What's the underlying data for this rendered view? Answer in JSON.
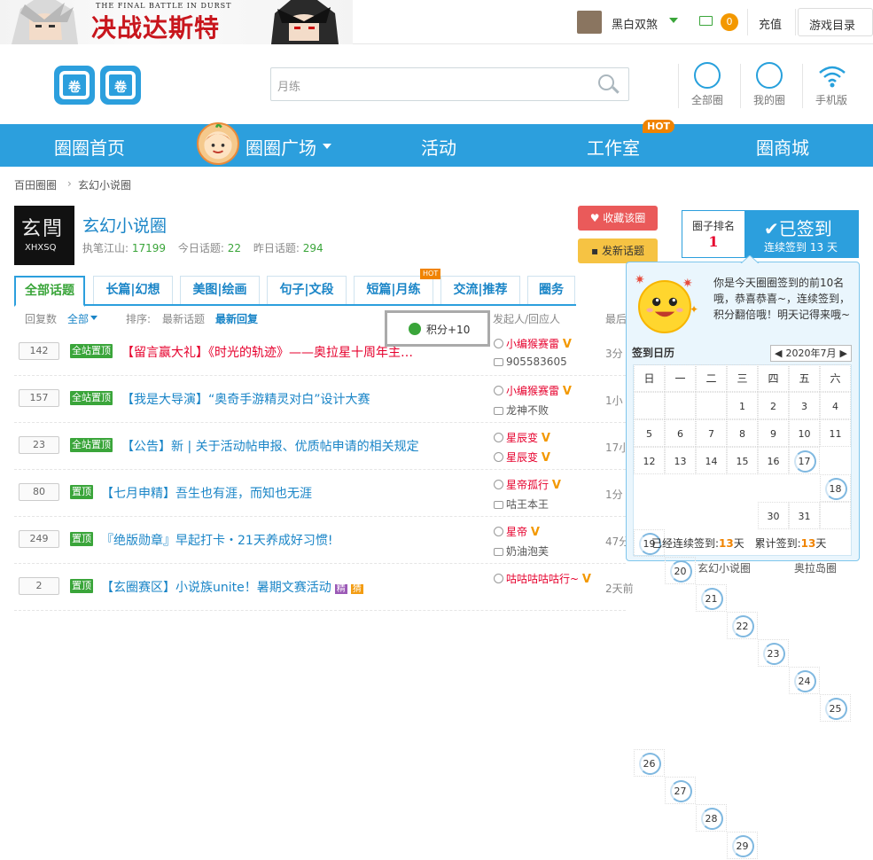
{
  "topbar": {
    "banner_subtitle": "THE FINAL BATTLE IN DURST",
    "banner_title": "决战达斯特",
    "username": "黑白双煞",
    "mail_count": "0",
    "recharge": "充值",
    "game_directory": "游戏目录"
  },
  "header": {
    "logo_text": "圈圈",
    "search_value": "月练",
    "links": [
      "全部圈",
      "我的圈",
      "手机版"
    ]
  },
  "nav": {
    "items": [
      "圈圈首页",
      "圈圈广场",
      "活动",
      "工作室",
      "圈商城"
    ],
    "hot_badge": "HOT"
  },
  "breadcrumb": [
    "百田圈圈",
    "玄幻小说圈"
  ],
  "group": {
    "avatar_text": "玄閆",
    "avatar_sub": "XHXSQ",
    "name": "玄幻小说圈",
    "owner_label": "执笔江山:",
    "owner_value": "17199",
    "today_label": "今日话题:",
    "today_value": "22",
    "yesterday_label": "昨日话题:",
    "yesterday_value": "294",
    "fav_button": "收藏该圈",
    "post_button": "发新话题"
  },
  "ranking": {
    "label": "圈子排名",
    "value": "1",
    "signed": "已签到",
    "streak_label": "连续签到",
    "streak_value": "13",
    "streak_unit": "天"
  },
  "tabs": [
    "全部话题",
    "长篇|幻想",
    "美图|绘画",
    "句子|文段",
    "短篇|月练",
    "交流|推荐",
    "圈务"
  ],
  "tab_hot": "HOT",
  "filter": {
    "reply_label": "回复数",
    "all": "全部",
    "sort_label": "排序:",
    "latest_topic": "最新话题",
    "latest_reply": "最新回复",
    "author_col": "发起人/回应人",
    "time_col": "最后"
  },
  "topics": [
    {
      "count": "142",
      "tag": "全站置顶",
      "title_red": "【留言赢大礼】《时光的轨迹》——奥拉星十周年主…",
      "title": "",
      "author": "小编猴赛雷",
      "responder": "905583605",
      "time": "3分"
    },
    {
      "count": "157",
      "tag": "全站置顶",
      "title_red": "",
      "title": "【我是大导演】“奥奇手游精灵对白”设计大赛",
      "author": "小编猴赛雷",
      "responder": "龙神不败",
      "time": "1小"
    },
    {
      "count": "23",
      "tag": "全站置顶",
      "title_red": "",
      "title": "【公告】新 | 关于活动帖申报、优质帖申请的相关规定",
      "author": "星辰变",
      "responder": "星辰变",
      "time": "17小"
    },
    {
      "count": "80",
      "tag": "置顶",
      "title_red": "",
      "title": "【七月申精】吾生也有涯，而知也无涯",
      "author": "星帝孤行",
      "responder": "咕王本王",
      "time": "1分"
    },
    {
      "count": "249",
      "tag": "置顶",
      "title_red": "",
      "title": "『绝版勋章』早起打卡・21天养成好习惯!",
      "author": "星帝",
      "responder": "奶油泡芙",
      "time": "47分"
    },
    {
      "count": "2",
      "tag": "置顶",
      "title_red": "",
      "title": "【玄圈赛区】小说族unite！暑期文赛活动",
      "author": "咕咕咕咕咕行~",
      "responder": "",
      "time": "2天前"
    }
  ],
  "topic_minitags": [
    "精",
    "猜"
  ],
  "toast": "积分+10",
  "popup": {
    "message": "你是今天圈圈签到的前10名哦，恭喜恭喜~，连续签到，积分翻倍哦！明天记得来哦~",
    "calendar_title": "签到日历",
    "month": "2020年7月",
    "weekdays": [
      "日",
      "一",
      "二",
      "三",
      "四",
      "五",
      "六"
    ],
    "days": [
      "",
      "",
      "",
      "1",
      "2",
      "3",
      "4",
      "5",
      "6",
      "7",
      "8",
      "9",
      "10",
      "11",
      "12",
      "13",
      "14",
      "15",
      "16",
      "17",
      "18",
      "19",
      "20",
      "21",
      "22",
      "23",
      "24",
      "25",
      "26",
      "27",
      "28",
      "29",
      "30",
      "31",
      ""
    ],
    "signed_days": [
      "17",
      "18",
      "19",
      "20",
      "21",
      "22",
      "23",
      "24",
      "25",
      "26",
      "27",
      "28",
      "29"
    ],
    "streak_label": "已经连续签到:",
    "streak_value": "13",
    "total_label": "累计签到:",
    "total_value": "13",
    "day_unit": "天"
  },
  "below_popup": [
    "玄幻小说圈",
    "奥拉岛圈"
  ]
}
